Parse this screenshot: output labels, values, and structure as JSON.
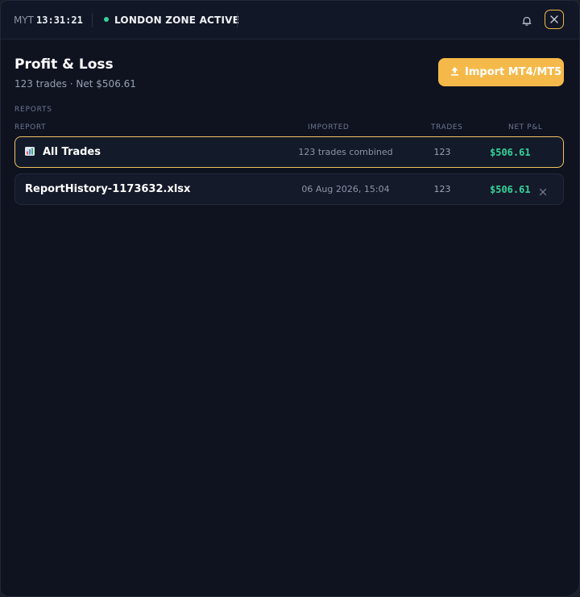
{
  "topbar": {
    "timezone": "MYT",
    "time": "13:31:21",
    "zone_status": "LONDON ZONE ACTIVE",
    "zone_color": "#34d399",
    "bell_icon": "bell-icon",
    "close_icon": "close-icon"
  },
  "header": {
    "title": "Profit & Loss",
    "subtitle": "123 trades · Net $506.61",
    "import_label": "Import MT4/MT5",
    "import_icon": "upload-icon",
    "accent_color": "#f5b94a"
  },
  "reports": {
    "section_label": "REPORTS",
    "columns": {
      "report": "REPORT",
      "imported": "IMPORTED",
      "trades": "TRADES",
      "net_pnl": "NET P&L"
    },
    "rows": [
      {
        "icon": "bar-chart-icon",
        "name": "All Trades",
        "imported": "123 trades combined",
        "trades": "123",
        "net_pnl": "$506.61",
        "selected": true
      },
      {
        "name": "ReportHistory-1173632.xlsx",
        "imported": "06 Aug 2026, 15:04",
        "trades": "123",
        "net_pnl": "$506.61",
        "remove_icon": "remove-icon"
      }
    ],
    "positive_color": "#34d399"
  }
}
